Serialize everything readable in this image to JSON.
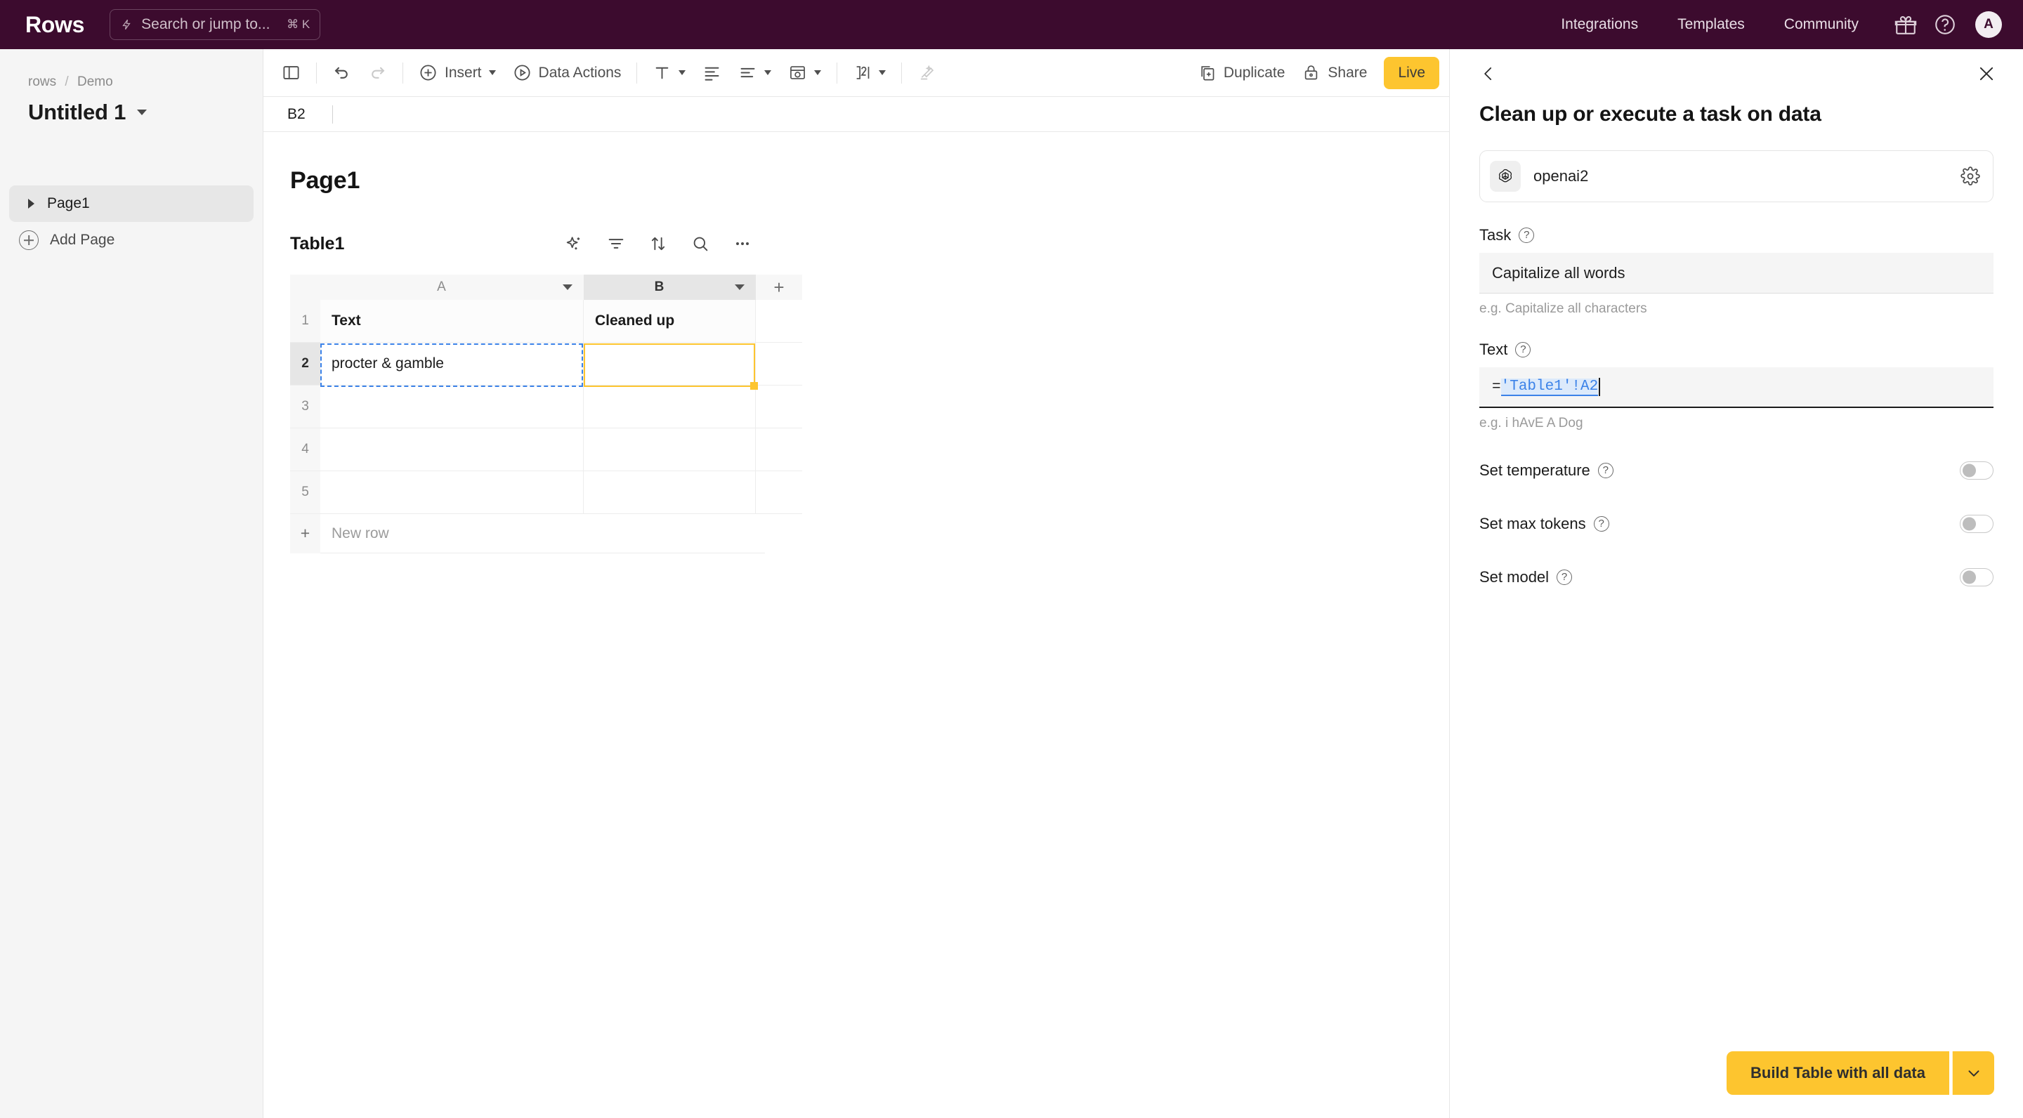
{
  "topbar": {
    "brand": "Rows",
    "search_placeholder": "Search or jump to...",
    "search_shortcut": "⌘ K",
    "links": [
      {
        "label": "Integrations"
      },
      {
        "label": "Templates"
      },
      {
        "label": "Community"
      }
    ],
    "gift_icon": "gift-icon",
    "help_icon": "help-circle-icon",
    "avatar_initial": "A",
    "bar_color": "#3C0B2E"
  },
  "sidebar": {
    "breadcrumb": {
      "workspace": "rows",
      "separator": "/",
      "folder": "Demo"
    },
    "doc_title": "Untitled 1",
    "pages": [
      {
        "label": "Page1",
        "active": true
      }
    ],
    "add_page_label": "Add Page"
  },
  "toolbar": {
    "panel_toggle_icon": "sidebar-toggle-icon",
    "undo_icon": "undo-icon",
    "redo_icon": "redo-icon",
    "insert_label": "Insert",
    "data_actions_label": "Data Actions",
    "text_format_icon": "text-format-icon",
    "align_icon": "align-icon",
    "cell_style_icon": "cell-style-icon",
    "number_format_icon": "number-format-icon",
    "clear_format_icon": "clear-format-icon",
    "duplicate_label": "Duplicate",
    "share_label": "Share",
    "live_label": "Live",
    "live_color": "#FDC52F"
  },
  "formula_bar": {
    "cell_reference": "B2",
    "value": ""
  },
  "canvas": {
    "page_heading": "Page1",
    "table": {
      "name": "Table1",
      "tools": [
        "ai-sparkle-icon",
        "filter-icon",
        "sort-icon",
        "search-icon",
        "more-options-icon"
      ],
      "columns": [
        {
          "letter": "A",
          "selected": false
        },
        {
          "letter": "B",
          "selected": true
        }
      ],
      "add_column_label": "+",
      "rows": [
        {
          "num": "1",
          "a": "Text",
          "b": "Cleaned up",
          "header": true
        },
        {
          "num": "2",
          "a": "procter & gamble",
          "b": "",
          "header": false
        },
        {
          "num": "3",
          "a": "",
          "b": "",
          "header": false
        },
        {
          "num": "4",
          "a": "",
          "b": "",
          "header": false
        },
        {
          "num": "5",
          "a": "",
          "b": "",
          "header": false
        }
      ],
      "new_row_label": "New row",
      "new_row_plus": "+",
      "selection": {
        "active_cell": "B2",
        "copy_source": "A2",
        "copy_border_color": "#3B82E8",
        "active_border_color": "#FDC52F"
      }
    }
  },
  "panel": {
    "back_icon": "chevron-left-icon",
    "close_icon": "close-icon",
    "title": "Clean up or execute a task on data",
    "integration": {
      "name": "openai2",
      "logo": "openai-icon",
      "settings_icon": "gear-icon"
    },
    "task_field": {
      "label": "Task",
      "help_icon": "help-circle-icon",
      "value": "Capitalize all words",
      "hint": "e.g. Capitalize all characters"
    },
    "text_field": {
      "label": "Text",
      "help_icon": "help-circle-icon",
      "prefix": "=",
      "reference": "'Table1'!A2",
      "hint": "e.g. i hAvE A Dog",
      "focused": true
    },
    "toggles": [
      {
        "label": "Set temperature",
        "help_icon": "help-circle-icon",
        "on": false
      },
      {
        "label": "Set max tokens",
        "help_icon": "help-circle-icon",
        "on": false
      },
      {
        "label": "Set model",
        "help_icon": "help-circle-icon",
        "on": false
      }
    ],
    "footer": {
      "build_label": "Build Table with all data",
      "dropdown_icon": "chevron-down-icon",
      "button_color": "#FDC52F"
    }
  }
}
